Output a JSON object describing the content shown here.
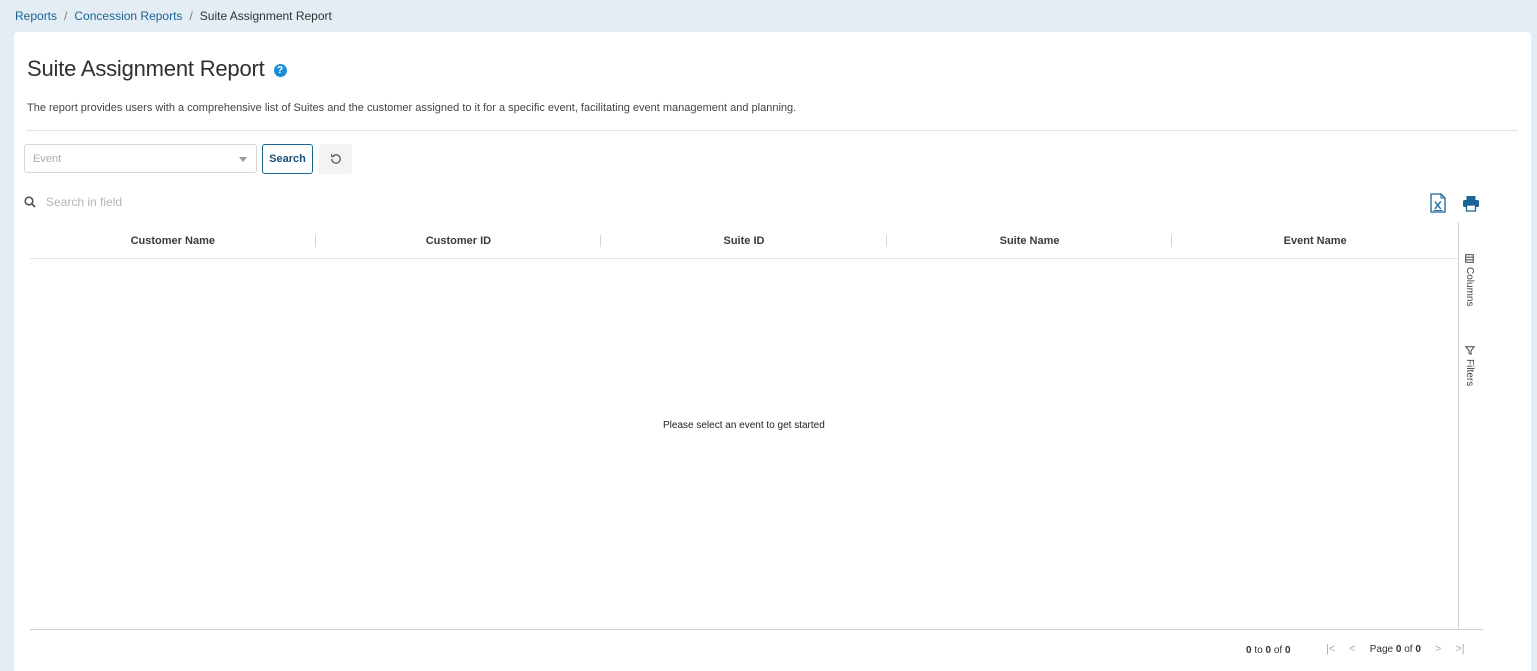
{
  "breadcrumb": {
    "items": [
      "Reports",
      "Concession Reports"
    ],
    "separator": "/",
    "current": "Suite Assignment Report"
  },
  "header": {
    "title": "Suite Assignment Report",
    "help_icon": "question-circle-icon",
    "description": "The report provides users with a comprehensive list of Suites and the customer assigned to it for a specific event, facilitating event management and planning."
  },
  "filters": {
    "event_placeholder": "Event",
    "search_label": "Search",
    "reset_icon": "reset-icon"
  },
  "grid": {
    "search_placeholder": "Search in field",
    "columns": [
      "Customer Name",
      "Customer ID",
      "Suite ID",
      "Suite Name",
      "Event Name"
    ],
    "empty_message": "Please select an event to get started",
    "side_panel": {
      "columns_label": "Columns",
      "filters_label": "Filters"
    },
    "footer": {
      "range_from": "0",
      "range_to_word": "to",
      "range_to": "0",
      "range_of_word": "of",
      "range_total": "0",
      "page_word": "Page",
      "page_current": "0",
      "page_of_word": "of",
      "page_total": "0"
    }
  },
  "colors": {
    "link": "#1a6496",
    "accent": "#1a8fd6",
    "background": "#e4edf3"
  }
}
